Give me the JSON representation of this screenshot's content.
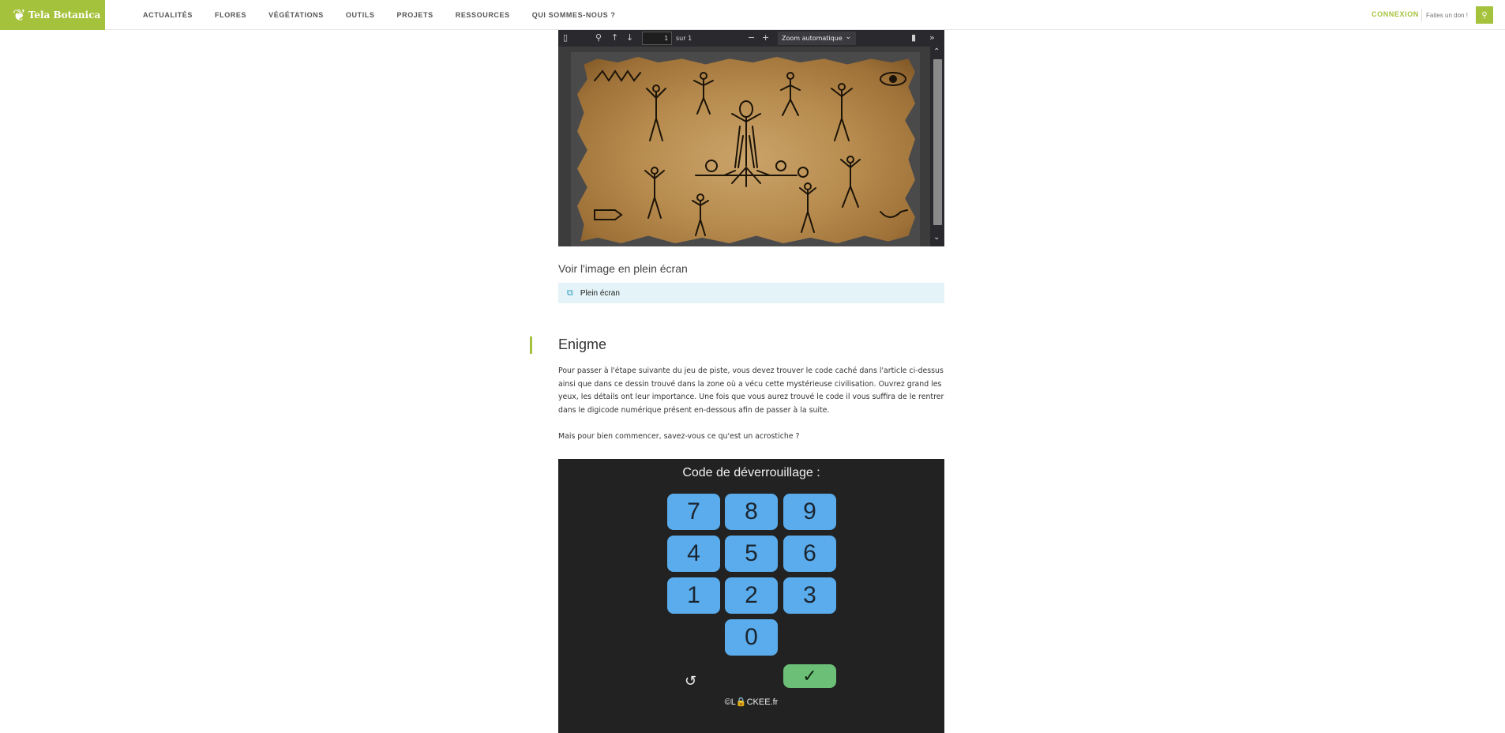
{
  "header": {
    "logo_text": "Tela Botanica",
    "nav": [
      "ACTUALITÉS",
      "FLORES",
      "VÉGÉTATIONS",
      "OUTILS",
      "PROJETS",
      "RESSOURCES",
      "QUI SOMMES-NOUS ?"
    ],
    "login": "CONNEXION",
    "donate_placeholder": "Faites un don !",
    "accent_color": "#a5c23c"
  },
  "pdf_viewer": {
    "page_value": "1",
    "page_of": "sur 1",
    "zoom": "Zoom automatique"
  },
  "fullscreen": {
    "heading": "Voir l'image en plein écran",
    "link": "Plein écran"
  },
  "enigme": {
    "title": "Enigme",
    "paragraph1": "Pour passer à l'étape suivante du jeu de piste, vous devez trouver le code caché dans l'article ci-dessus ainsi que dans ce dessin trouvé dans la zone où a vécu cette mystérieuse civilisation. Ouvrez grand les yeux, les détails ont leur importance. Une fois que vous aurez trouvé le code il vous suffira de le rentrer dans le digicode numérique présent en-dessous afin de passer à la suite.",
    "paragraph2": "Mais pour bien commencer, savez-vous ce qu'est un acrostiche ?"
  },
  "lock": {
    "title": "Code de déverrouillage :",
    "keys": [
      "7",
      "8",
      "9",
      "4",
      "5",
      "6",
      "1",
      "2",
      "3",
      "0"
    ],
    "reset": "↺",
    "validate": "✓",
    "brand": "©L🔒CKEE.fr",
    "key_color": "#5aacec",
    "validate_color": "#6bbf76"
  }
}
